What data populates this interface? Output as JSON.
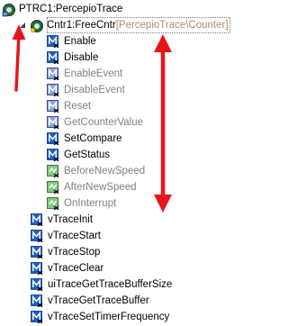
{
  "tree": {
    "root": {
      "label": "PTRC1:PercepioTrace",
      "expanded": true
    },
    "component": {
      "name": "Cntr1:FreeCntr",
      "path": "[PercepioTrace\\Counter]",
      "expanded": true
    },
    "component_methods": [
      {
        "label": "Enable",
        "enabled": true,
        "kind": "method"
      },
      {
        "label": "Disable",
        "enabled": true,
        "kind": "method"
      },
      {
        "label": "EnableEvent",
        "enabled": false,
        "kind": "method"
      },
      {
        "label": "DisableEvent",
        "enabled": false,
        "kind": "method"
      },
      {
        "label": "Reset",
        "enabled": false,
        "kind": "method"
      },
      {
        "label": "GetCounterValue",
        "enabled": false,
        "kind": "method"
      },
      {
        "label": "SetCompare",
        "enabled": true,
        "kind": "method"
      },
      {
        "label": "GetStatus",
        "enabled": true,
        "kind": "method"
      },
      {
        "label": "BeforeNewSpeed",
        "enabled": false,
        "kind": "event"
      },
      {
        "label": "AfterNewSpeed",
        "enabled": false,
        "kind": "event"
      },
      {
        "label": "OnInterrupt",
        "enabled": false,
        "kind": "event"
      }
    ],
    "root_methods": [
      {
        "label": "vTraceInit",
        "kind": "method"
      },
      {
        "label": "vTraceStart",
        "kind": "method"
      },
      {
        "label": "vTraceStop",
        "kind": "method"
      },
      {
        "label": "vTraceClear",
        "kind": "method"
      },
      {
        "label": "uiTraceGetTraceBufferSize",
        "kind": "method"
      },
      {
        "label": "vTraceGetTraceBuffer",
        "kind": "method"
      },
      {
        "label": "vTraceSetTimerFrequency",
        "kind": "method"
      }
    ]
  },
  "colors": {
    "annotation_red": "#e8141c",
    "method_icon_blue": "#1f5fc8",
    "method_icon_disabled": "#8aa6d8",
    "event_icon_green": "#2e9a2e",
    "event_icon_disabled": "#86c986",
    "path_text": "#b48a6a",
    "disabled_text": "#808080"
  }
}
